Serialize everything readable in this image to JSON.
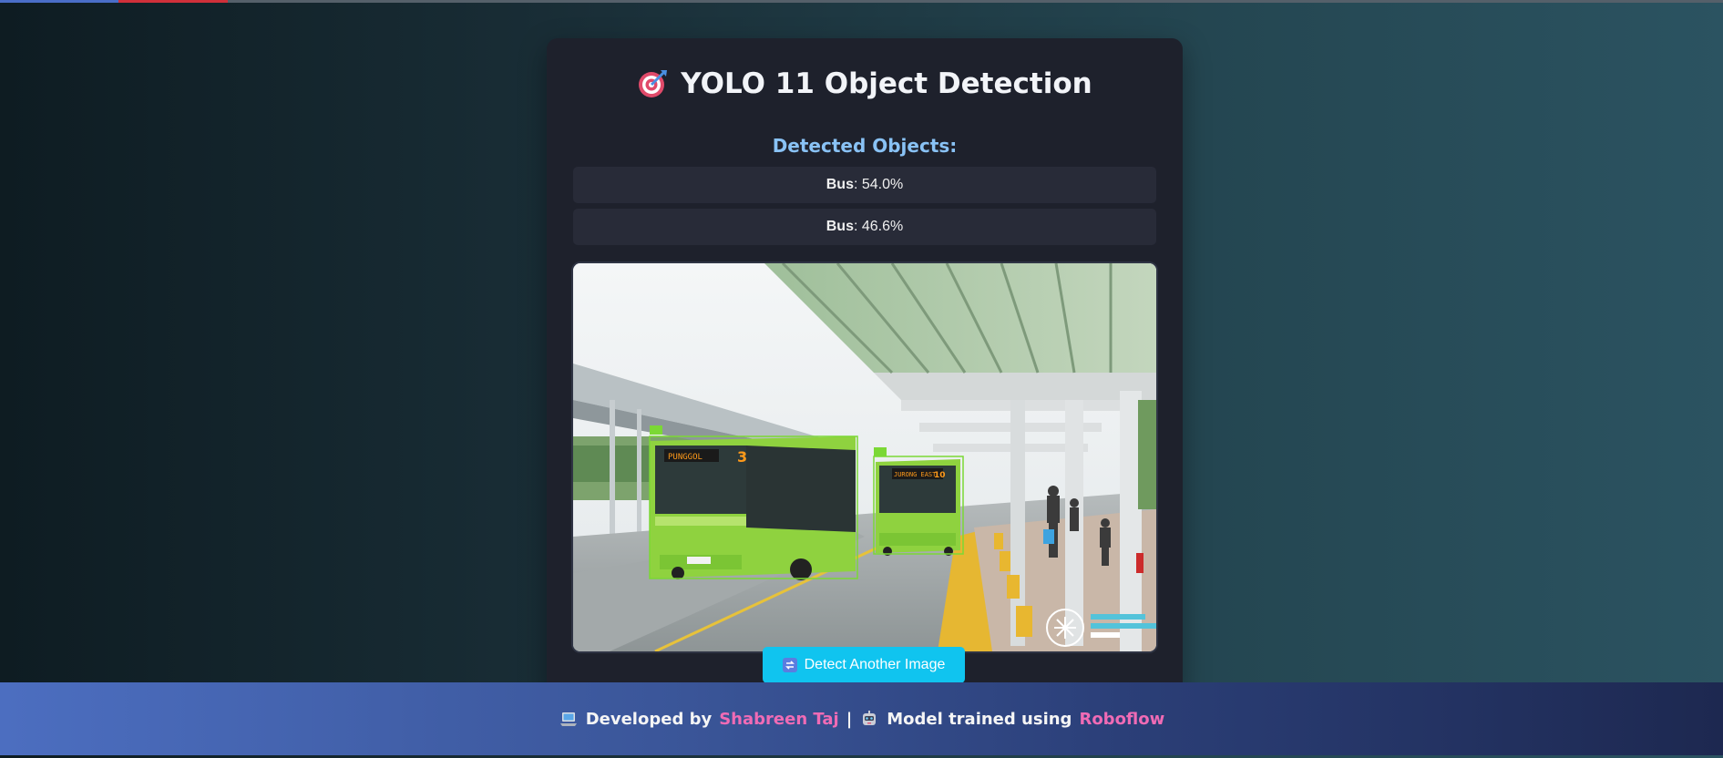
{
  "header": {
    "title": "YOLO 11 Object Detection",
    "title_icon": "target-icon"
  },
  "detections": {
    "heading": "Detected Objects:",
    "items": [
      {
        "label": "Bus",
        "confidence": ": 54.0%"
      },
      {
        "label": "Bus",
        "confidence": ": 46.6%"
      }
    ]
  },
  "result_image": {
    "alt": "Detection result with bounding boxes on two green buses at a bus interchange",
    "box_color": "#7bd835"
  },
  "actions": {
    "detect_again_label": "Detect Another Image",
    "detect_again_icon": "refresh-icon"
  },
  "footer": {
    "developed_by": "Developed by",
    "developer_name": "Shabreen Taj",
    "separator": "|",
    "trained_using": "Model trained using",
    "platform_name": "Roboflow",
    "laptop_icon": "laptop-icon",
    "robot_icon": "robot-icon"
  },
  "colors": {
    "accent": "#10c4ef",
    "heading": "#89c2f5",
    "link": "#f06bb5",
    "card": "#1e212c"
  }
}
